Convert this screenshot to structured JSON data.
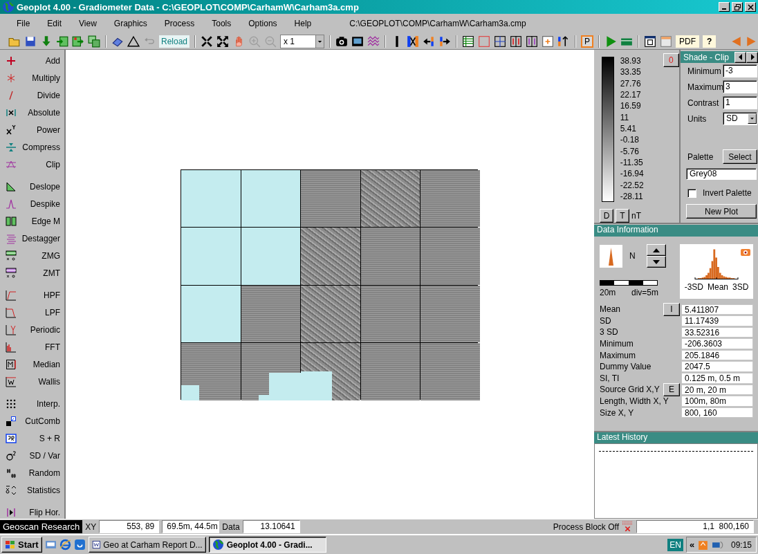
{
  "window": {
    "title": "Geoplot 4.00 - Gradiometer Data - C:\\GEOPLOT\\COMP\\CarhamW\\Carham3a.cmp"
  },
  "menu": {
    "items": [
      "File",
      "Edit",
      "View",
      "Graphics",
      "Process",
      "Tools",
      "Options",
      "Help"
    ],
    "path": "C:\\GEOPLOT\\COMP\\CarhamW\\Carham3a.cmp"
  },
  "toolbar": {
    "reload": "Reload",
    "zoom": "x 1",
    "plot_toggle": "P",
    "pdf": "PDF",
    "help": "?"
  },
  "sidebar": {
    "groups": [
      {
        "items": [
          {
            "label": "Add"
          },
          {
            "label": "Multiply"
          },
          {
            "label": "Divide"
          },
          {
            "label": "Absolute"
          },
          {
            "label": "Power"
          },
          {
            "label": "Compress"
          },
          {
            "label": "Clip"
          }
        ]
      },
      {
        "items": [
          {
            "label": "Deslope"
          },
          {
            "label": "Despike"
          },
          {
            "label": "Edge M"
          },
          {
            "label": "Destagger"
          },
          {
            "label": "ZMG"
          },
          {
            "label": "ZMT"
          }
        ]
      },
      {
        "items": [
          {
            "label": "HPF"
          },
          {
            "label": "LPF"
          },
          {
            "label": "Periodic"
          },
          {
            "label": "FFT"
          },
          {
            "label": "Median"
          },
          {
            "label": "Wallis"
          }
        ]
      },
      {
        "items": [
          {
            "label": "Interp."
          },
          {
            "label": "CutComb"
          },
          {
            "label": "S + R"
          },
          {
            "label": "SD / Var"
          },
          {
            "label": "Random"
          },
          {
            "label": "Statistics"
          }
        ]
      },
      {
        "items": [
          {
            "label": "Flip Hor."
          }
        ]
      }
    ]
  },
  "scale": {
    "labels": [
      "38.93",
      "33.35",
      "27.76",
      "22.17",
      "16.59",
      "11",
      "5.41",
      "-0.18",
      "-5.76",
      "-11.35",
      "-16.94",
      "-22.52",
      "-28.11"
    ],
    "zero_button": "0",
    "buttons": [
      "D",
      "T"
    ],
    "units": "nT"
  },
  "shade_clip": {
    "title": "Shade - Clip",
    "fields": [
      {
        "label": "Minimum",
        "value": "-3"
      },
      {
        "label": "Maximum",
        "value": "3"
      },
      {
        "label": "Contrast",
        "value": "1"
      }
    ],
    "units": {
      "label": "Units",
      "value": "SD"
    },
    "palette": {
      "label": "Palette",
      "button": "Select",
      "value": "Grey08"
    },
    "invert": {
      "label": "Invert Palette",
      "checked": false
    },
    "new_plot": "New Plot"
  },
  "data_information": {
    "title": "Data Information",
    "north": "N",
    "scale_bar": {
      "length": "20m",
      "division": "div=5m"
    },
    "histogram": {
      "labels": [
        "-3SD",
        "Mean",
        "3SD"
      ]
    },
    "rows": [
      {
        "label": "Mean",
        "button": "I",
        "value": "5.411807"
      },
      {
        "label": "SD",
        "value": "11.17439"
      },
      {
        "label": "3 SD",
        "value": "33.52316"
      },
      {
        "label": "Minimum",
        "value": "-206.3603"
      },
      {
        "label": "Maximum",
        "value": "205.1846"
      },
      {
        "label": "Dummy Value",
        "value": "2047.5"
      },
      {
        "label": "SI, TI",
        "value": "0.125 m, 0.5 m"
      },
      {
        "label": "Source Grid X,Y",
        "button": "E",
        "value": "20 m, 20 m"
      },
      {
        "label": "Length, Width X, Y",
        "value": "100m, 80m"
      },
      {
        "label": "Size X, Y",
        "value": "800, 160"
      }
    ]
  },
  "latest_history": {
    "title": "Latest History"
  },
  "status_bar": {
    "brand": "Geoscan Research",
    "xy_label": "XY",
    "xy": "553, 89",
    "position": "69.5m, 44.5m",
    "data_label": "Data",
    "data": "13.10641",
    "process_block": "Process Block Off",
    "block_range": "1,1  800,160"
  },
  "taskbar": {
    "start": "Start",
    "tasks": [
      {
        "label": "Geo at Carham Report D...",
        "selected": false
      },
      {
        "label": "Geoplot 4.00 - Gradi...",
        "selected": true
      }
    ],
    "language": "EN",
    "tray_expand": "«",
    "clock": "09:15"
  }
}
